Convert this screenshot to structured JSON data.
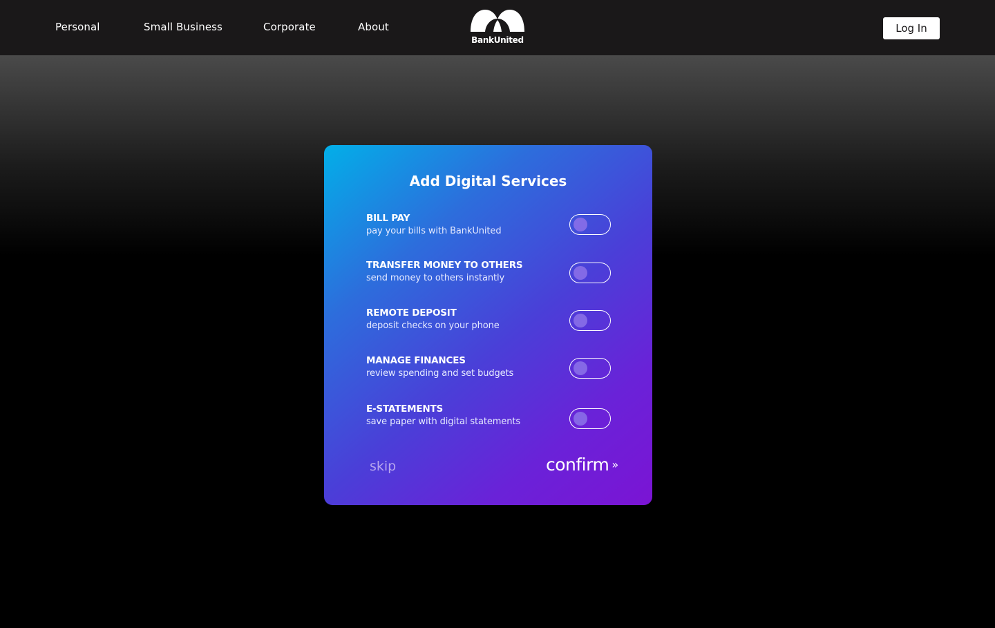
{
  "nav": {
    "items": [
      "Personal",
      "Small Business",
      "Corporate",
      "About"
    ],
    "logo_text": "BankUnited",
    "login_label": "Log In"
  },
  "card": {
    "title": "Add Digital Services",
    "services": [
      {
        "title": "BILL PAY",
        "desc": "pay your bills with BankUnited",
        "enabled": false
      },
      {
        "title": "TRANSFER MONEY TO OTHERS",
        "desc": "send money to others instantly",
        "enabled": false
      },
      {
        "title": "REMOTE DEPOSIT",
        "desc": "deposit checks on your phone",
        "enabled": false
      },
      {
        "title": "MANAGE FINANCES",
        "desc": "review spending and set budgets",
        "enabled": false
      },
      {
        "title": "E-STATEMENTS",
        "desc": "save paper with digital statements",
        "enabled": false
      }
    ],
    "skip_label": "skip",
    "confirm_label": "confirm",
    "confirm_icon": "double-chevron-right-icon"
  },
  "colors": {
    "navbar_bg": "#1a1819",
    "card_gradient_start": "#02afe8",
    "card_gradient_end": "#7b14d4",
    "toggle_knob": "#8a6fe8"
  }
}
